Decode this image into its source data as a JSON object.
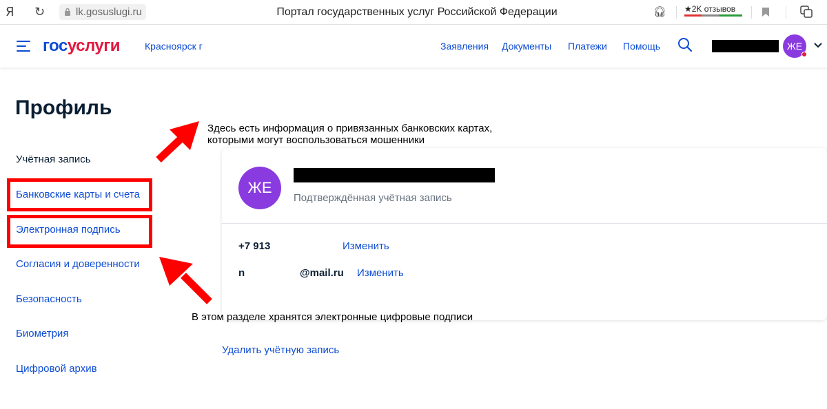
{
  "browser": {
    "logo_letter": "Я",
    "url": "lk.gosuslugi.ru",
    "tab_title": "Портал государственных услуг Российской Федерации",
    "reviews": "★2K отзывов"
  },
  "header": {
    "logo_part1": "гос",
    "logo_part2": "услуги",
    "city": "Красноярск г",
    "nav": [
      "Заявления",
      "Документы",
      "Платежи",
      "Помощь"
    ],
    "avatar_initials": "ЖЕ"
  },
  "page": {
    "title": "Профиль"
  },
  "sidebar": {
    "items": [
      {
        "label": "Учётная запись",
        "active": true
      },
      {
        "label": "Банковские карты и счета"
      },
      {
        "label": "Электронная подпись"
      },
      {
        "label": "Согласия и доверенности"
      },
      {
        "label": "Безопасность"
      },
      {
        "label": "Биометрия"
      },
      {
        "label": "Цифровой архив"
      }
    ]
  },
  "annotations": {
    "top_line1": "Здесь есть информация о привязанных банковских картах,",
    "top_line2": "которыми могут воспользоваться мошенники",
    "bottom": "В этом разделе хранятся электронные цифровые подписи"
  },
  "colors": {
    "brand_blue": "#0d4cd3",
    "brand_red": "#e3173e",
    "avatar_purple": "#8a3be0",
    "highlight_red": "#ff0000"
  },
  "profile_card": {
    "avatar_initials": "ЖЕ",
    "status": "Подтверждённая учётная запись",
    "phone": "+7 913",
    "email_prefix": "n",
    "email_domain": "@mail.ru",
    "change_label": "Изменить"
  },
  "delete_account": "Удалить учётную запись"
}
